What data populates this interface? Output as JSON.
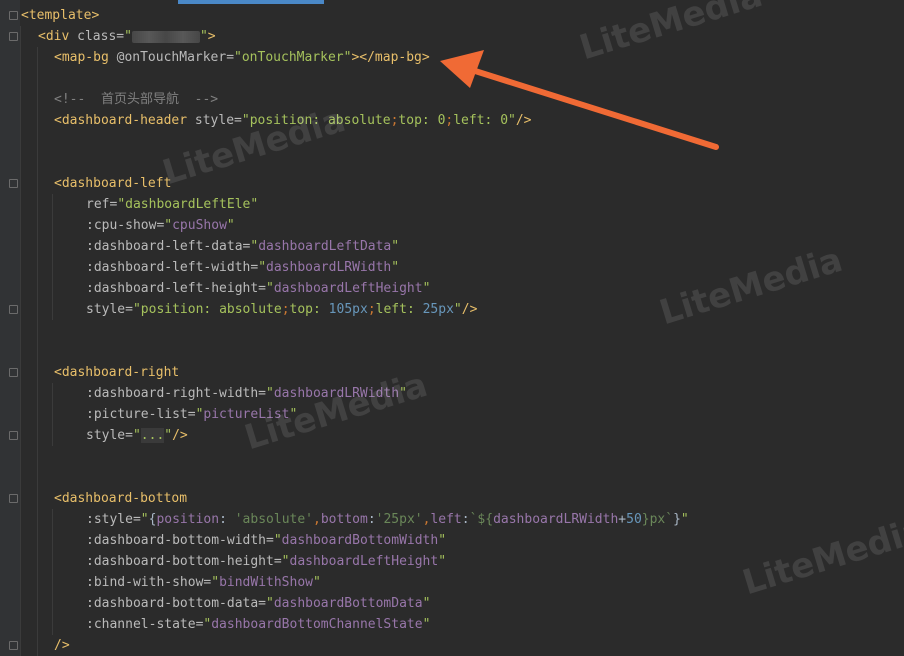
{
  "editor": {
    "watermark_text": "LiteMedia",
    "colors": {
      "background": "#2b2b2b",
      "tag": "#e8bf6a",
      "attribute": "#bababa",
      "string": "#a5c25c",
      "expression": "#9876aa",
      "number": "#6897bb",
      "comment": "#808080",
      "annotation_arrow": "#f06a35"
    }
  },
  "code": {
    "l1_tag": "<template>",
    "l2_open": "<div ",
    "l2_attr": "class=",
    "l2_q1": "\"",
    "l2_q2": "\"",
    "l2_close": ">",
    "l3_open": "<map-bg ",
    "l3_attr": "@onTouchMarker=",
    "l3_val": "\"onTouchMarker\"",
    "l3_mid": "></map-bg",
    "l3_close": ">",
    "l5_comment": "<!--  首页头部导航  -->",
    "l6_open": "<dashboard-header ",
    "l6_attr": "style=",
    "l6_q": "\"",
    "l6_p1": "position",
    "l6_c1": ": ",
    "l6_v1": "absolute",
    "l6_s1": ";",
    "l6_p2": "top",
    "l6_c2": ": ",
    "l6_v2": "0",
    "l6_s2": ";",
    "l6_p3": "left",
    "l6_c3": ": ",
    "l6_v3": "0",
    "l6_q2": "\"",
    "l6_close": "/>",
    "l9_tag": "<dashboard-left",
    "l10_attr": "ref=",
    "l10_val": "\"dashboardLeftEle\"",
    "l11_attr": ":cpu-show=",
    "l11_q1": "\"",
    "l11_expr": "cpuShow",
    "l11_q2": "\"",
    "l12_attr": ":dashboard-left-data=",
    "l12_q1": "\"",
    "l12_expr": "dashboardLeftData",
    "l12_q2": "\"",
    "l13_attr": ":dashboard-left-width=",
    "l13_q1": "\"",
    "l13_expr": "dashboardLRWidth",
    "l13_q2": "\"",
    "l14_attr": ":dashboard-left-height=",
    "l14_q1": "\"",
    "l14_expr": "dashboardLeftHeight",
    "l14_q2": "\"",
    "l15_attr": "style=",
    "l15_q": "\"",
    "l15_p1": "position",
    "l15_c1": ": ",
    "l15_v1": "absolute",
    "l15_s1": ";",
    "l15_p2": "top",
    "l15_c2": ": ",
    "l15_v2": "105px",
    "l15_s2": ";",
    "l15_p3": "left",
    "l15_c3": ": ",
    "l15_v3": "25px",
    "l15_q2": "\"",
    "l15_close": "/>",
    "l18_tag": "<dashboard-right",
    "l19_attr": ":dashboard-right-width=",
    "l19_q1": "\"",
    "l19_expr": "dashboardLRWidth",
    "l19_q2": "\"",
    "l20_attr": ":picture-list=",
    "l20_q1": "\"",
    "l20_expr": "pictureList",
    "l20_q2": "\"",
    "l21_attr": "style=",
    "l21_q1": "\"",
    "l21_val": "...",
    "l21_q2": "\"",
    "l21_close": "/>",
    "l24_tag": "<dashboard-bottom",
    "l25_attr": ":style=",
    "l25_q1": "\"",
    "l25_b1": "{",
    "l25_k1": "position",
    "l25_c1": ": ",
    "l25_v1": "'absolute'",
    "l25_cm1": ",",
    "l25_k2": "bottom",
    "l25_c2": ":",
    "l25_v2": "'25px'",
    "l25_cm2": ",",
    "l25_k3": "left",
    "l25_c3": ":",
    "l25_t1": "`${",
    "l25_e1": "dashboardLRWidth",
    "l25_plus": "+",
    "l25_n1": "50",
    "l25_t2": "}px`",
    "l25_b2": "}",
    "l25_q2": "\"",
    "l26_attr": ":dashboard-bottom-width=",
    "l26_q1": "\"",
    "l26_expr": "dashboardBottomWidth",
    "l26_q2": "\"",
    "l27_attr": ":dashboard-bottom-height=",
    "l27_q1": "\"",
    "l27_expr": "dashboardLeftHeight",
    "l27_q2": "\"",
    "l28_attr": ":bind-with-show=",
    "l28_q1": "\"",
    "l28_expr": "bindWithShow",
    "l28_q2": "\"",
    "l29_attr": ":dashboard-bottom-data=",
    "l29_q1": "\"",
    "l29_expr": "dashboardBottomData",
    "l29_q2": "\"",
    "l30_attr": ":channel-state=",
    "l30_q1": "\"",
    "l30_expr": "dashboardBottomChannelState",
    "l30_q2": "\"",
    "l31_close": "/>"
  }
}
